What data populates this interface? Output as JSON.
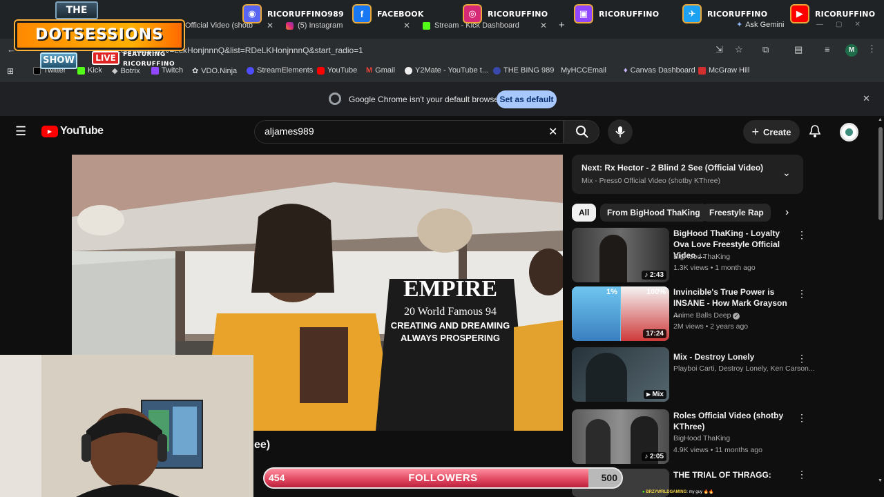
{
  "tabs": [
    {
      "label": "Official Video (shotb",
      "active": true
    },
    {
      "label": "(5) Instagram"
    },
    {
      "label": "Stream - Kick Dashboard"
    }
  ],
  "ask_gemini": "Ask Gemini",
  "address": {
    "url": ".com/watch?v=eckHonjnnnQ&list=RDeLKHonjnnnQ&start_radio=1",
    "profile_initial": "M"
  },
  "bookmarks": [
    "Twitter",
    "Kick",
    "Botrix",
    "Twitch",
    "VDO.Ninja",
    "StreamElements",
    "YouTube",
    "Gmail",
    "Y2Mate - YouTube t...",
    "THE BING 989",
    "MyHCCEmail",
    "Canvas Dashboard",
    "McGraw Hill"
  ],
  "infobar": {
    "message": "Google Chrome isn't your default browser",
    "button": "Set as default"
  },
  "overlay": {
    "logo_the": "THE",
    "logo_main": "DOTSESSIONS",
    "logo_show": "SHOW",
    "live": "LIVE",
    "featuring": "FEATURING",
    "featuring_name": "RICORUFFINO",
    "social": [
      {
        "name": "RICORUFFINO989",
        "icon": "discord-icon",
        "color": "#5865f2"
      },
      {
        "name": "FACEBOOK",
        "icon": "facebook-icon",
        "color": "#1877f2"
      },
      {
        "name": "RICORUFFINO",
        "icon": "instagram-icon",
        "color": "#d62976"
      },
      {
        "name": "RICORUFFINO",
        "icon": "twitch-icon",
        "color": "#9146ff"
      },
      {
        "name": "RICORUFFINO",
        "icon": "twitter-icon",
        "color": "#1da1f2"
      },
      {
        "name": "RICORUFFINO",
        "icon": "youtube-icon",
        "color": "#ff0000"
      }
    ],
    "followers": {
      "current": "454",
      "label": "FOLLOWERS",
      "goal": "500",
      "progress": 0.908
    },
    "chat": {
      "user": "BRZYWRLDGAMING",
      "message": ": my guy"
    }
  },
  "youtube": {
    "logo_text": "YouTube",
    "search_value": "aljames989",
    "create": "Create",
    "video_title_fragment": "ee)",
    "next": {
      "title": "Next: Rx Hector - 2 Blind 2 See (Official Video)",
      "subtitle": "Mix - Press0 Official Video (shotby KThree)"
    },
    "chips": [
      "All",
      "From BigHood ThaKing",
      "Freestyle Rap"
    ],
    "recs": [
      {
        "title": "BigHood ThaKing - Loyalty Ova Love Freestyle Official Video ...",
        "channel": "BigHood ThaKing",
        "meta": "1.3K views • 1 month ago",
        "duration": "2:43"
      },
      {
        "title": "Invincible's True Power is INSANE - How Mark Grayson ...",
        "channel": "Anime Balls Deep",
        "meta": "2M views • 2 years ago",
        "duration": "17:24",
        "verified": true,
        "thumb_left": "1%",
        "thumb_right": "100%"
      },
      {
        "title": "Mix - Destroy Lonely",
        "channel": "Playboi Carti, Destroy Lonely, Ken Carson...",
        "meta": "",
        "duration": "Mix"
      },
      {
        "title": "Roles Official Video (shotby KThree)",
        "channel": "BigHood ThaKing",
        "meta": "4.9K views • 11 months ago",
        "duration": "2:05"
      },
      {
        "title": "THE TRIAL OF THRAGG:",
        "channel": "",
        "meta": "",
        "duration": ""
      }
    ],
    "shirt": {
      "l1": "EMPIRE",
      "l2": "20 World Famous 94",
      "l3": "CREATING AND DREAMING",
      "l4": "ALWAYS PROSPERING"
    }
  }
}
